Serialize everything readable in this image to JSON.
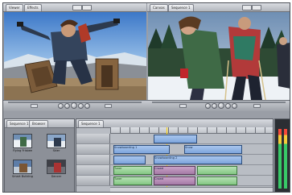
{
  "viewer": {
    "tabs": [
      "Viewer",
      "Effects"
    ]
  },
  "canvas": {
    "tabs": [
      "Canvas",
      "Sequence 1"
    ]
  },
  "browser": {
    "tabs": [
      "Sequence 1",
      "Browser"
    ],
    "items": [
      {
        "label": "Flying Frisbee"
      },
      {
        "label": "Skier"
      },
      {
        "label": "Smart Building"
      },
      {
        "label": "Dancer"
      }
    ]
  },
  "timeline": {
    "tabs": [
      "Sequence 1"
    ],
    "clips": {
      "v2_a": "Snowboarding 1",
      "v2_b": "Snow",
      "v1_a": "Snowboarding 2",
      "a1_a": "Tuner",
      "a1_b": "Crowd",
      "a2_a": "Tuner",
      "a2_b": "Crowd"
    }
  },
  "colors": {
    "panel": "#9a9ea6",
    "video_clip": "#7ea5dc",
    "audio_clip": "#84c783",
    "audio_clip_alt": "#a57aa6"
  }
}
